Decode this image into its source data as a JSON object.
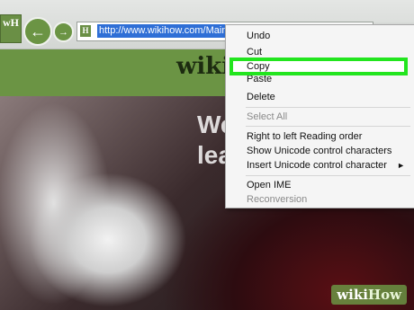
{
  "browser": {
    "favicon_letters": "wH",
    "url": "http://www.wikihow.com/Main-",
    "url_icon": "H",
    "back_icon": "back-arrow-icon",
    "forward_icon": "forward-arrow-icon"
  },
  "site": {
    "logo_text": "wiki",
    "hero_text_line1": "We",
    "hero_text_line2": "lea",
    "watermark_wiki": "wiki",
    "watermark_how": "How"
  },
  "context_menu": {
    "items": [
      {
        "label": "Undo",
        "enabled": true
      },
      {
        "label": "Cut",
        "enabled": true
      },
      {
        "label": "Copy",
        "enabled": true,
        "highlighted": true
      },
      {
        "label": "Paste",
        "enabled": true
      },
      {
        "label": "Delete",
        "enabled": true
      },
      {
        "label": "Select All",
        "enabled": false
      },
      {
        "label": "Right to left Reading order",
        "enabled": true
      },
      {
        "label": "Show Unicode control characters",
        "enabled": true
      },
      {
        "label": "Insert Unicode control character",
        "enabled": true,
        "submenu": true
      },
      {
        "label": "Open IME",
        "enabled": true
      },
      {
        "label": "Reconversion",
        "enabled": false
      }
    ],
    "highlight_color": "#22e51e"
  },
  "colors": {
    "wikihow_green": "#6b9444",
    "selection_blue": "#2f6fd6"
  }
}
